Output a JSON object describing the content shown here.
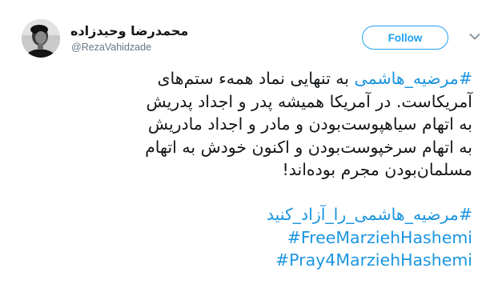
{
  "author": {
    "display_name": "محمدرضا وحیدزاده",
    "handle": "@RezaVahidzade",
    "avatar_icon": "profile-photo"
  },
  "actions": {
    "follow_label": "Follow",
    "more_icon": "chevron-down-icon"
  },
  "tweet": {
    "hashtag_main": "#مرضیه_هاشمی",
    "line1_rest": " به تنهایی نماد همهء ستم‌های",
    "line2": "آمریکاست. در آمریکا همیشه پدر و اجداد پدریش",
    "line3": "به اتهام سیاهپوست‌بودن و مادر و اجداد مادریش",
    "line4": "به اتهام سرخپوست‌بودن و اکنون خودش به اتهام",
    "line5": "مسلمان‌بودن مجرم بوده‌اند!",
    "hashtags": [
      "#مرضیه_هاشمی_را_آزاد_کنید",
      "#FreeMarziehHashemi",
      "#Pray4MarziehHashemi"
    ]
  },
  "colors": {
    "link": "#1b95e0",
    "follow": "#1da1f2",
    "text": "#14171a",
    "muted": "#657786"
  }
}
